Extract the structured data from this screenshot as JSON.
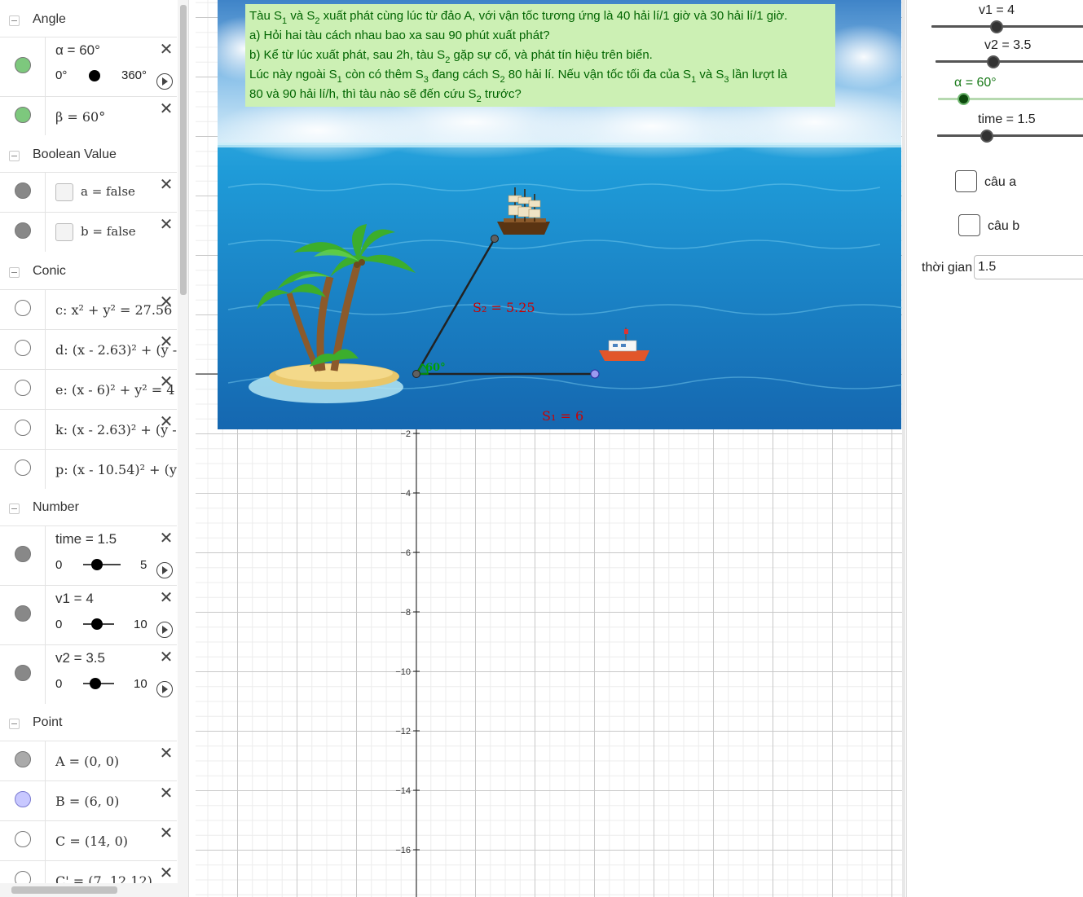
{
  "algebra": {
    "groups": {
      "angle": "Angle",
      "boolean": "Boolean Value",
      "conic": "Conic",
      "number": "Number",
      "point": "Point"
    },
    "angle_rows": {
      "alpha": {
        "label": "α = 60°",
        "min": "0°",
        "max": "360°",
        "color": "#7dc87d"
      },
      "beta": {
        "label": "β = 60°",
        "color": "#7dc87d"
      }
    },
    "boolean_rows": {
      "a": {
        "label": "a  =  false"
      },
      "b": {
        "label": "b  =  false"
      }
    },
    "conic_rows": [
      {
        "label": "c: x² + y² = 27.56"
      },
      {
        "label": "d: (x - 2.63)² + (y -"
      },
      {
        "label": "e: (x - 6)² + y² = 4"
      },
      {
        "label": "k: (x - 2.63)² + (y -"
      },
      {
        "label": "p: (x - 10.54)² + (y"
      }
    ],
    "number_rows": {
      "time": {
        "label": "time = 1.5",
        "min": "0",
        "max": "5",
        "value": 1.5,
        "range": [
          0,
          5
        ]
      },
      "v1": {
        "label": "v1 = 4",
        "min": "0",
        "max": "10",
        "value": 4,
        "range": [
          0,
          10
        ]
      },
      "v2": {
        "label": "v2 = 3.5",
        "min": "0",
        "max": "10",
        "value": 3.5,
        "range": [
          0,
          10
        ]
      }
    },
    "point_rows": [
      {
        "label": "A = (0, 0)",
        "color": "#aaaaaa"
      },
      {
        "label": "B = (6, 0)",
        "color": "#c8c8ff"
      },
      {
        "label": "C = (14, 0)",
        "color": "#ffffff"
      },
      {
        "label": "C' = (7, 12.12)",
        "color": "#ffffff"
      }
    ]
  },
  "graphics": {
    "problem": {
      "line1_a": "Tàu S",
      "line1_b": "1",
      "line1_c": " và S",
      "line1_d": "2",
      "line1_e": " xuất phát cùng lúc từ đảo A, với vận tốc tương ứng là 40 hải lí/1 giờ và 30 hải lí/1 giờ.",
      "line2": "a) Hỏi hai tàu cách nhau bao xa sau 90 phút xuất phát?",
      "line3_a": "b) Kể từ lúc xuất phát, sau 2h, tàu S",
      "line3_b": "2",
      "line3_c": " gặp sự cố, và phát tín hiệu trên biển.",
      "line4_a": "Lúc này ngoài S",
      "line4_b": "1",
      "line4_c": " còn có thêm S",
      "line4_d": "3",
      "line4_e": " đang cách S",
      "line4_f": "2",
      "line4_g": " 80 hải lí. Nếu vận tốc tối đa của S",
      "line4_h": "1",
      "line4_i": " và S",
      "line4_j": "3",
      "line4_k": " lần lượt là",
      "line5_a": "80 và 90 hải lí/h, thì tàu nào sẽ đến cứu S",
      "line5_b": "2",
      "line5_c": " trước?"
    },
    "labels": {
      "s2": "S₂ = 5.25",
      "s1": "S₁ = 6",
      "angle": "60°"
    },
    "y_ticks": [
      "−2",
      "−4",
      "−6",
      "−8",
      "−10",
      "−12",
      "−14",
      "−16"
    ],
    "colors": {
      "problem_bg": "#ccf0b4",
      "problem_text": "#006400",
      "label_red": "#cc0000",
      "angle_green": "#00a000"
    }
  },
  "right_panel": {
    "sliders": {
      "v1": {
        "label": "v1 = 4",
        "value": 4
      },
      "v2": {
        "label": "v2 = 3.5",
        "value": 3.5
      },
      "alpha": {
        "label": "α = 60°",
        "value": 60
      },
      "time": {
        "label": "time = 1.5",
        "value": 1.5
      }
    },
    "checkboxes": {
      "cau_a": "câu a",
      "cau_b": "câu b"
    },
    "input": {
      "label": "thời gian",
      "value": "1.5"
    }
  }
}
